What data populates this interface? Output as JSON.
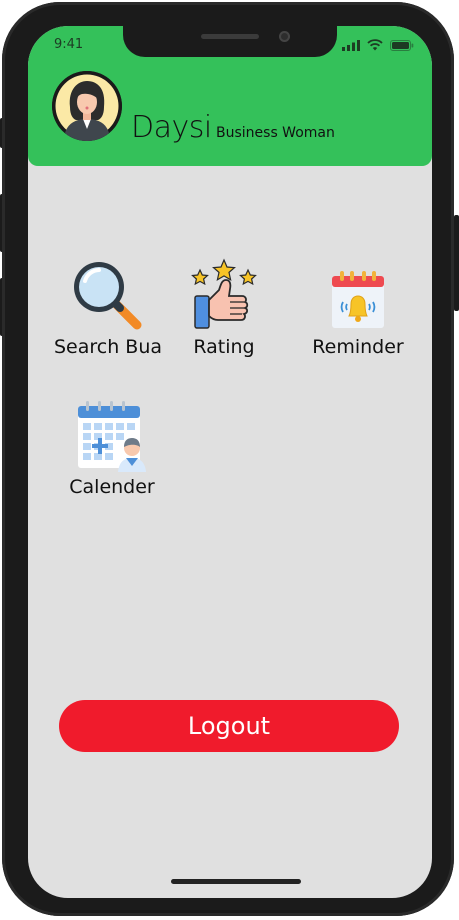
{
  "status_bar": {
    "time": "9:41"
  },
  "profile": {
    "name": "Daysi",
    "role": "Business Woman"
  },
  "menu": {
    "items": [
      {
        "label": "Search Bua",
        "icon": "magnifier-icon"
      },
      {
        "label": "Rating",
        "icon": "thumbs-up-stars-icon"
      },
      {
        "label": "Reminder",
        "icon": "calendar-bell-icon"
      },
      {
        "label": "Calender",
        "icon": "calendar-doctor-icon"
      }
    ]
  },
  "logout": {
    "label": "Logout"
  },
  "colors": {
    "header": "#34c15a",
    "background": "#e0e0e0",
    "logout": "#f01b2c"
  }
}
